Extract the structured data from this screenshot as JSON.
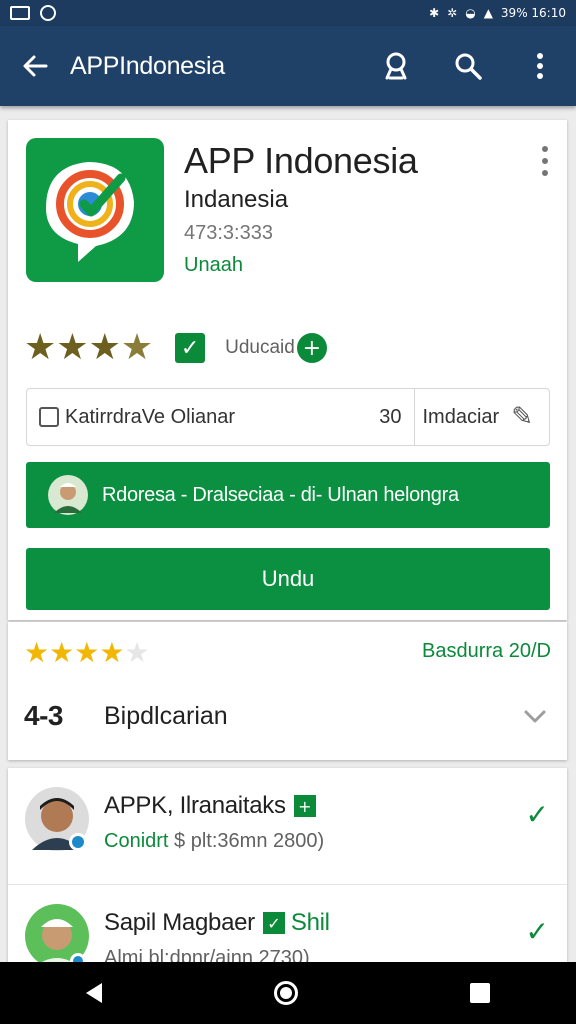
{
  "status_bar": {
    "right_text": "39% 16:10",
    "left_icons": [
      "gallery-icon",
      "shield-icon"
    ],
    "right_icons": [
      "bluetooth-icon",
      "vibrate-icon",
      "wifi-icon",
      "signal-icon"
    ]
  },
  "appbar": {
    "title": "APPIndonesia",
    "actions": [
      "account-icon",
      "search-icon",
      "more-vert-icon"
    ]
  },
  "app": {
    "name": "APP Indonesia",
    "developer": "Indanesia",
    "count": "473:3:333",
    "status": "Unaah",
    "rating_stars": 3.5,
    "verified_label": "Uducaid",
    "info_label": "KatirrdraVe Olianar",
    "info_number": "30",
    "info_label2": "Imdaciar",
    "promo_text": "Rdoresa - Dralseciaa - di- Ulnan helongra",
    "install_label": "Undu"
  },
  "ratings": {
    "stars": 4,
    "date": "Basdurra 20/D",
    "count": "4-3",
    "label": "Bipdlcarian"
  },
  "reviews": [
    {
      "name": "APPK, Ilranaitaks",
      "tag_icon": "plus-box-icon",
      "tag_text": "",
      "sub_green": "Conidrt",
      "sub_rest": "$ plt:36mn 2800)"
    },
    {
      "name": "Sapil Magbaer",
      "tag_icon": "check-box-icon",
      "tag_text": "Shil",
      "sub_green": "",
      "sub_rest": "Almi bl:dpnr/ainn 2730)"
    }
  ],
  "colors": {
    "appbar": "#1f4168",
    "status_bar": "#1d3a5f",
    "accent_green": "#0b8f40",
    "star_gold": "#f2b705"
  }
}
